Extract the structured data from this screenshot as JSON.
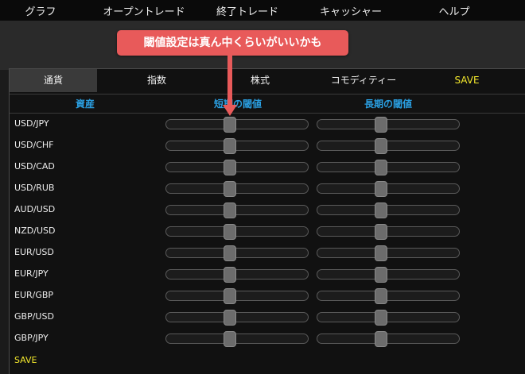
{
  "topnav": {
    "items": [
      {
        "label": "グラフ"
      },
      {
        "label": "オープントレード"
      },
      {
        "label": "終了トレード"
      },
      {
        "label": "キャッシャー"
      },
      {
        "label": "ヘルプ"
      }
    ]
  },
  "callout": {
    "text": "閾値設定は真ん中くらいがいいかも"
  },
  "tabs": [
    {
      "label": "通貨",
      "active": true
    },
    {
      "label": "指数"
    },
    {
      "label": "株式"
    },
    {
      "label": "コモディティー"
    },
    {
      "label": "SAVE"
    }
  ],
  "columns": {
    "asset": "資産",
    "short_threshold": "短期の閾値",
    "long_threshold": "長期の閾値"
  },
  "rows": [
    {
      "asset": "USD/JPY",
      "short_value": 0.45,
      "long_value": 0.45
    },
    {
      "asset": "USD/CHF",
      "short_value": 0.45,
      "long_value": 0.45
    },
    {
      "asset": "USD/CAD",
      "short_value": 0.45,
      "long_value": 0.45
    },
    {
      "asset": "USD/RUB",
      "short_value": 0.45,
      "long_value": 0.45
    },
    {
      "asset": "AUD/USD",
      "short_value": 0.45,
      "long_value": 0.45
    },
    {
      "asset": "NZD/USD",
      "short_value": 0.45,
      "long_value": 0.45
    },
    {
      "asset": "EUR/USD",
      "short_value": 0.45,
      "long_value": 0.45
    },
    {
      "asset": "EUR/JPY",
      "short_value": 0.45,
      "long_value": 0.45
    },
    {
      "asset": "EUR/GBP",
      "short_value": 0.45,
      "long_value": 0.45
    },
    {
      "asset": "GBP/USD",
      "short_value": 0.45,
      "long_value": 0.45
    },
    {
      "asset": "GBP/JPY",
      "short_value": 0.45,
      "long_value": 0.45
    }
  ],
  "save_label": "SAVE",
  "colors": {
    "accent_blue": "#2a9ee0",
    "save_yellow": "#f3e82c",
    "callout_red": "#e85a5a"
  }
}
